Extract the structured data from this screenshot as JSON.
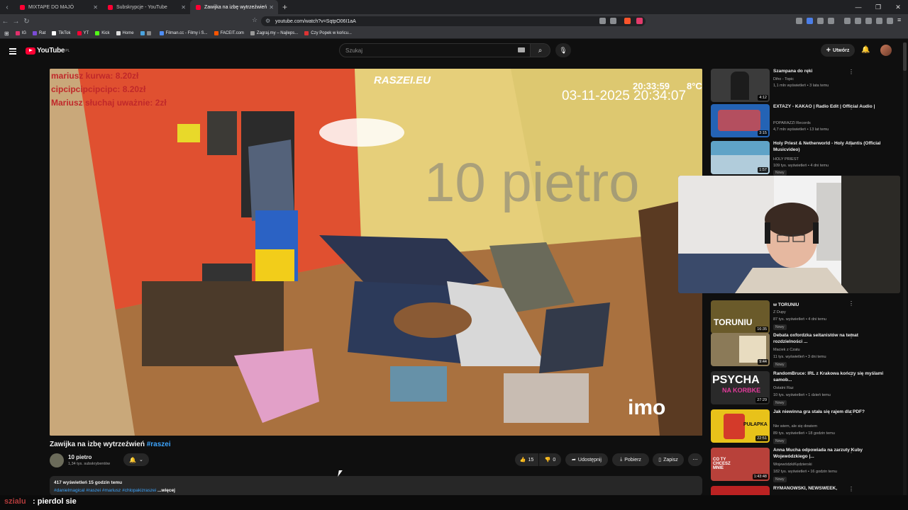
{
  "browser": {
    "tabs": [
      {
        "label": "MIXTAPE DO MAJÓ"
      },
      {
        "label": "Subskrypcje - YouTube"
      },
      {
        "label": "Zawijka na izbę wytrzeźwień"
      }
    ],
    "url": "youtube.com/watch?v=SqtpO06I1aA",
    "bookmarks": [
      {
        "label": "IG",
        "color": "#e1306c"
      },
      {
        "label": "Rat",
        "color": "#7b4bd6"
      },
      {
        "label": "TikTok",
        "color": "#ffffff"
      },
      {
        "label": "YT",
        "color": "#ff0033"
      },
      {
        "label": "Kick",
        "color": "#53fc18"
      },
      {
        "label": "Home",
        "color": "#dddddd"
      },
      {
        "label": "",
        "color": "#4aa3df"
      },
      {
        "label": "Filman.cc - Filmy i S...",
        "color": "#4f8ef7"
      },
      {
        "label": "FACEIT.com",
        "color": "#ff5500"
      },
      {
        "label": "Zagraj.my – Najleps...",
        "color": "#999999"
      },
      {
        "label": "Czy Popek w końcu...",
        "color": "#d33"
      }
    ]
  },
  "youtube": {
    "logo": "YouTube",
    "logo_region": "PL",
    "search_placeholder": "Szukaj",
    "create_label": "Utwórz"
  },
  "video": {
    "overlay": {
      "line1": "mariusz kurwa: 8.20zł",
      "line2": "cipcipcipcipcipc: 8.20zł",
      "line3": "Mariusz słuchaj uważnie: 2zł",
      "watermark_site": "RASZEI.EU",
      "clock": "20:33:59",
      "temp": "8°C",
      "datetime": "03-11-2025 20:34:07",
      "room": "10 pietro",
      "cam_logo": "imo"
    },
    "title": "Zawijka na izbę wytrzeźwień",
    "title_tag": "#raszei",
    "channel": "10 pietro",
    "subscribers": "1,34 tys. subskrybentów",
    "likes": "15",
    "dislikes": "0",
    "share_label": "Udostępnij",
    "download_label": "Pobierz",
    "save_label": "Zapisz",
    "views": "417 wyświetleń  15 godzin temu",
    "hashtags": "#danielmagical #raszei #mariusz #chlopakizraszei",
    "more_label": "...więcej"
  },
  "recommendations": [
    {
      "title": "Szampana do ręki",
      "channel": "Diho - Topic",
      "meta": "1,1 mln wyświetleń • 3 lata temu",
      "duration": "4:12",
      "new": "",
      "thumb": "#3b3b3b"
    },
    {
      "title": "EXTAZY - KAKAO | Radio Edit | Official Audio |",
      "channel": "POPARAZZI Records",
      "meta": "4,7 mln wyświetleń • 13 lat temu",
      "duration": "3:15",
      "new": "",
      "thumb": "#2463b5"
    },
    {
      "title": "Holy Priest & Netherworld - Holy Atlantis (Official Musicvideo)",
      "channel": "HOLY PRIEST",
      "meta": "109 tys. wyświetleń • 4 dni temu",
      "duration": "1:57",
      "new": "Nowy",
      "thumb": "#5fa3c7"
    },
    {
      "title": "w TORUNIU",
      "channel": "Z Dupy",
      "meta": "87 tys. wyświetleń • 4 dni temu",
      "duration": "16:35",
      "new": "Nowy",
      "thumb": "#6a5a2a"
    },
    {
      "title": "Debata oxfordzka seitanistów na temat rozdzielności ...",
      "channel": "Maciek z Czatu",
      "meta": "11 tys. wyświetleń • 3 dni temu",
      "duration": "9:44",
      "new": "Nowy",
      "thumb": "#8b7a58"
    },
    {
      "title": "RandomBruce: IRL z Krakowa kończy się myślami samob...",
      "channel": "Ostatni Raz",
      "meta": "10 tys. wyświetleń • 1 dzień temu",
      "duration": "27:29",
      "new": "Nowy",
      "thumb": "#2a2a2a"
    },
    {
      "title": "Jak niewinna gra stała się rajem dla PDF?",
      "channel": "Nie wiem, ale się dowiem",
      "meta": "89 tys. wyświetleń • 18 godzin temu",
      "duration": "22:51",
      "new": "Nowy",
      "thumb": "#e8c21a"
    },
    {
      "title": "Anna Mucha odpowiada na zarzuty Kuby Wojewódzkiego |...",
      "channel": "WojewódzkiKędzierski",
      "meta": "182 tys. wyświetleń • 16 godzin temu",
      "duration": "1:43:48",
      "new": "Nowy",
      "thumb": "#b8413a"
    },
    {
      "title": "RYMANOWSKI, NEWSWEEK,",
      "channel": "",
      "meta": "",
      "duration": "",
      "new": "",
      "thumb": "#b22"
    }
  ],
  "thumb_texts": {
    "t4": "TORUNIU",
    "t6a": "PSYCHA",
    "t6b": "NA KORBKE",
    "t7": "PUŁAPKA",
    "t8": "CO TY CHCESZ MNIE"
  },
  "chat": {
    "user": "szialu",
    "message": ": pierdol sie"
  }
}
